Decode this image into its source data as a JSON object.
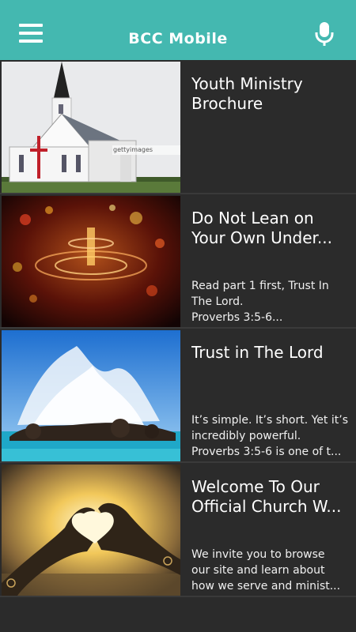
{
  "header": {
    "title": "BCC Mobile",
    "menu_icon": "hamburger-menu-icon",
    "mic_icon": "microphone-icon",
    "bar_color": "#44b8b0"
  },
  "items": [
    {
      "title_line1": "Youth Ministry",
      "title_line2": "Brochure",
      "desc_line1": "",
      "desc_line2": "",
      "desc_line3": "",
      "image_watermark": "gettyimages"
    },
    {
      "title_line1": "Do Not Lean on",
      "title_line2": "Your Own Under...",
      "desc_line1": "Read part 1 first, Trust In",
      "desc_line2": "The Lord.",
      "desc_line3": "Proverbs 3:5-6..."
    },
    {
      "title_line1": "Trust in The Lord",
      "title_line2": "",
      "desc_line1": "It’s simple. It’s short. Yet it’s",
      "desc_line2": "incredibly powerful.",
      "desc_line3": "Proverbs 3:5-6 is one of t..."
    },
    {
      "title_line1": "Welcome To Our",
      "title_line2": "Official Church W...",
      "desc_line1": "We invite you to browse",
      "desc_line2": "our site and learn about",
      "desc_line3": "how we serve and minist..."
    }
  ]
}
